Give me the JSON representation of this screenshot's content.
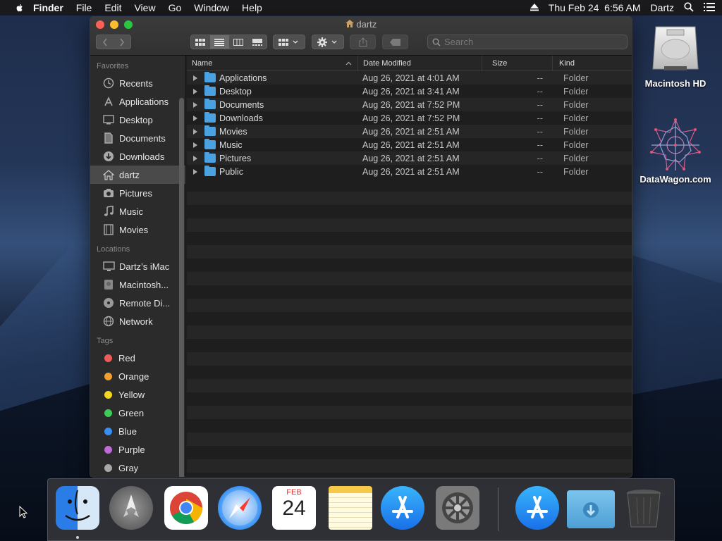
{
  "menubar": {
    "app": "Finder",
    "items": [
      "File",
      "Edit",
      "View",
      "Go",
      "Window",
      "Help"
    ],
    "datetime": "Thu Feb 24  6:56 AM",
    "user": "Dartz"
  },
  "window": {
    "title": "dartz",
    "search_placeholder": "Search"
  },
  "sidebar": {
    "favorites_header": "Favorites",
    "favorites": [
      {
        "label": "Recents",
        "icon": "clock-icon"
      },
      {
        "label": "Applications",
        "icon": "applications-icon"
      },
      {
        "label": "Desktop",
        "icon": "desktop-icon"
      },
      {
        "label": "Documents",
        "icon": "document-icon"
      },
      {
        "label": "Downloads",
        "icon": "download-icon"
      },
      {
        "label": "dartz",
        "icon": "home-icon",
        "selected": true
      },
      {
        "label": "Pictures",
        "icon": "camera-icon"
      },
      {
        "label": "Music",
        "icon": "music-note-icon"
      },
      {
        "label": "Movies",
        "icon": "film-icon"
      }
    ],
    "locations_header": "Locations",
    "locations": [
      {
        "label": "Dartz’s iMac",
        "icon": "imac-icon"
      },
      {
        "label": "Macintosh...",
        "icon": "hard-drive-icon"
      },
      {
        "label": "Remote Di...",
        "icon": "disc-icon"
      },
      {
        "label": "Network",
        "icon": "globe-icon"
      }
    ],
    "tags_header": "Tags",
    "tags": [
      {
        "label": "Red",
        "color": "#ee5b5b"
      },
      {
        "label": "Orange",
        "color": "#f0a030"
      },
      {
        "label": "Yellow",
        "color": "#f4d820"
      },
      {
        "label": "Green",
        "color": "#3fcc5a"
      },
      {
        "label": "Blue",
        "color": "#3a8ef0"
      },
      {
        "label": "Purple",
        "color": "#c06ad8"
      },
      {
        "label": "Gray",
        "color": "#a8a8a8"
      }
    ]
  },
  "columns": [
    "Name",
    "Date Modified",
    "Size",
    "Kind"
  ],
  "files": [
    {
      "name": "Applications",
      "date": "Aug 26, 2021 at 4:01 AM",
      "size": "--",
      "kind": "Folder"
    },
    {
      "name": "Desktop",
      "date": "Aug 26, 2021 at 3:41 AM",
      "size": "--",
      "kind": "Folder"
    },
    {
      "name": "Documents",
      "date": "Aug 26, 2021 at 7:52 PM",
      "size": "--",
      "kind": "Folder"
    },
    {
      "name": "Downloads",
      "date": "Aug 26, 2021 at 7:52 PM",
      "size": "--",
      "kind": "Folder"
    },
    {
      "name": "Movies",
      "date": "Aug 26, 2021 at 2:51 AM",
      "size": "--",
      "kind": "Folder"
    },
    {
      "name": "Music",
      "date": "Aug 26, 2021 at 2:51 AM",
      "size": "--",
      "kind": "Folder"
    },
    {
      "name": "Pictures",
      "date": "Aug 26, 2021 at 2:51 AM",
      "size": "--",
      "kind": "Folder"
    },
    {
      "name": "Public",
      "date": "Aug 26, 2021 at 2:51 AM",
      "size": "--",
      "kind": "Folder"
    }
  ],
  "desktop": {
    "icons": [
      "Macintosh HD",
      "DataWagon.com"
    ]
  },
  "dock": {
    "apps": [
      "finder-icon",
      "launchpad-icon",
      "chrome-icon",
      "safari-icon",
      "calendar-icon",
      "notes-icon",
      "app-store-icon",
      "system-preferences-icon",
      "app-store-download-icon",
      "downloads-folder-icon",
      "trash-icon"
    ],
    "calendar_month": "FEB",
    "calendar_day": "24"
  }
}
